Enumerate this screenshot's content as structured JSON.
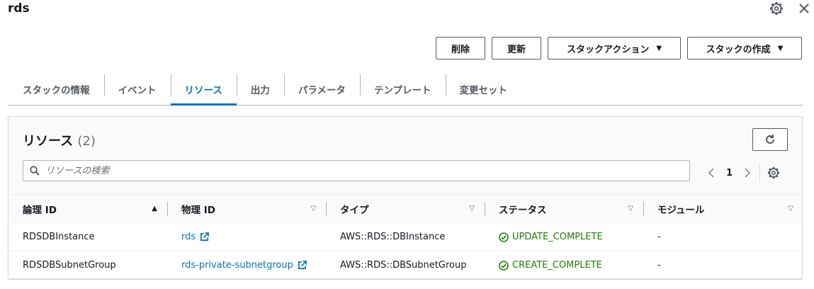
{
  "header": {
    "title": "rds"
  },
  "actions": {
    "delete": "削除",
    "update": "更新",
    "stack_actions": "スタックアクション",
    "create_stack": "スタックの作成"
  },
  "tabs": [
    {
      "label": "スタックの情報",
      "active": false
    },
    {
      "label": "イベント",
      "active": false
    },
    {
      "label": "リソース",
      "active": true
    },
    {
      "label": "出力",
      "active": false
    },
    {
      "label": "パラメータ",
      "active": false
    },
    {
      "label": "テンプレート",
      "active": false
    },
    {
      "label": "変更セット",
      "active": false
    }
  ],
  "panel": {
    "title": "リソース",
    "count": "(2)",
    "search_placeholder": "リソースの検索",
    "page": "1"
  },
  "table": {
    "columns": [
      "論理 ID",
      "物理 ID",
      "タイプ",
      "ステータス",
      "モジュール"
    ],
    "rows": [
      {
        "logical_id": "RDSDBInstance",
        "physical_id": "rds",
        "type": "AWS::RDS::DBInstance",
        "status": "UPDATE_COMPLETE",
        "module": "-"
      },
      {
        "logical_id": "RDSDBSubnetGroup",
        "physical_id": "rds-private-subnetgroup",
        "type": "AWS::RDS::DBSubnetGroup",
        "status": "CREATE_COMPLETE",
        "module": "-"
      }
    ]
  },
  "colors": {
    "accent": "#0073bb",
    "success": "#1d8102",
    "text": "#16191f",
    "muted": "#687078",
    "border": "#aab7b8"
  }
}
